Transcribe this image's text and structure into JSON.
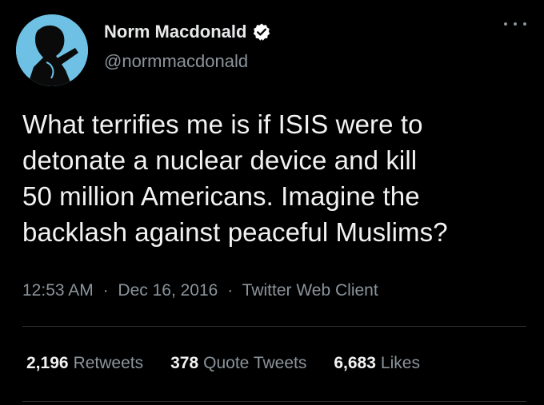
{
  "author": {
    "display_name": "Norm Macdonald",
    "handle": "@normmacdonald",
    "verified": true,
    "avatar_icon": "profile-silhouette",
    "avatar_bg": "#6ec1e4"
  },
  "tweet": {
    "text_lines": [
      "What terrifies me is if ISIS were to",
      "detonate a nuclear device and kill",
      "50 million Americans. Imagine the",
      "backlash against peaceful Muslims?"
    ],
    "time": "12:53 AM",
    "date": "Dec 16, 2016",
    "client": "Twitter Web Client",
    "separator": "·"
  },
  "stats": {
    "retweets": {
      "count": "2,196",
      "label": "Retweets"
    },
    "quotes": {
      "count": "378",
      "label": "Quote Tweets"
    },
    "likes": {
      "count": "6,683",
      "label": "Likes"
    }
  },
  "colors": {
    "background": "#000000",
    "text": "#f2f2f2",
    "secondary": "#8b949b",
    "verified": "#ffffff"
  }
}
